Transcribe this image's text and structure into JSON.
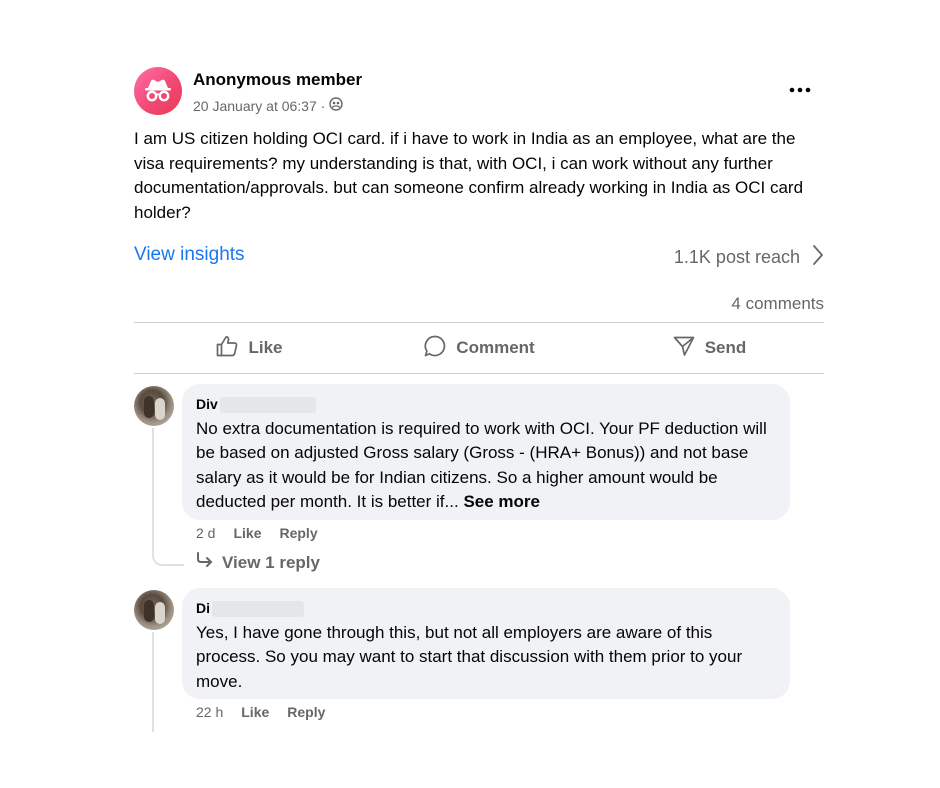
{
  "post": {
    "author": "Anonymous member",
    "date": "20 January at 06:37 ·",
    "body": "I am US citizen holding OCI card. if i have to work in India as an employee, what are the visa requirements? my understanding is that, with OCI, i can work without any further documentation/approvals. but can someone confirm already working in India as OCI card holder?",
    "insights_label": "View insights",
    "reach_label": "1.1K post reach",
    "comments_count": "4 comments",
    "actions": {
      "like": "Like",
      "comment": "Comment",
      "send": "Send"
    }
  },
  "comments": [
    {
      "name": "Div",
      "text": "No extra documentation is required to work with OCI. Your PF deduction will be based on adjusted Gross salary (Gross - (HRA+ Bonus)) and not base salary as it would be for Indian citizens. So a higher amount would be deducted per month. It is better if...",
      "see_more": "See more",
      "time": "2 d",
      "like": "Like",
      "reply": "Reply",
      "view_replies": "View 1 reply"
    },
    {
      "name": "Di",
      "text": "Yes, I have gone through this, but not all employers are aware of this process. So you may want to start that discussion with them prior to your move.",
      "time": "22 h",
      "like": "Like",
      "reply": "Reply"
    }
  ],
  "colors": {
    "link": "#1877f2",
    "secondary_text": "#65676b",
    "bubble": "#f0f2f5",
    "anon_avatar": "#f0466f"
  },
  "icons": {
    "author_avatar": "incognito-icon",
    "audience": "group-icon",
    "more": "more-dots-icon",
    "reach_chevron": "chevron-right-icon",
    "like": "thumbs-up-icon",
    "comment": "speech-bubble-icon",
    "send": "send-icon",
    "view_reply": "reply-arrow-icon"
  }
}
